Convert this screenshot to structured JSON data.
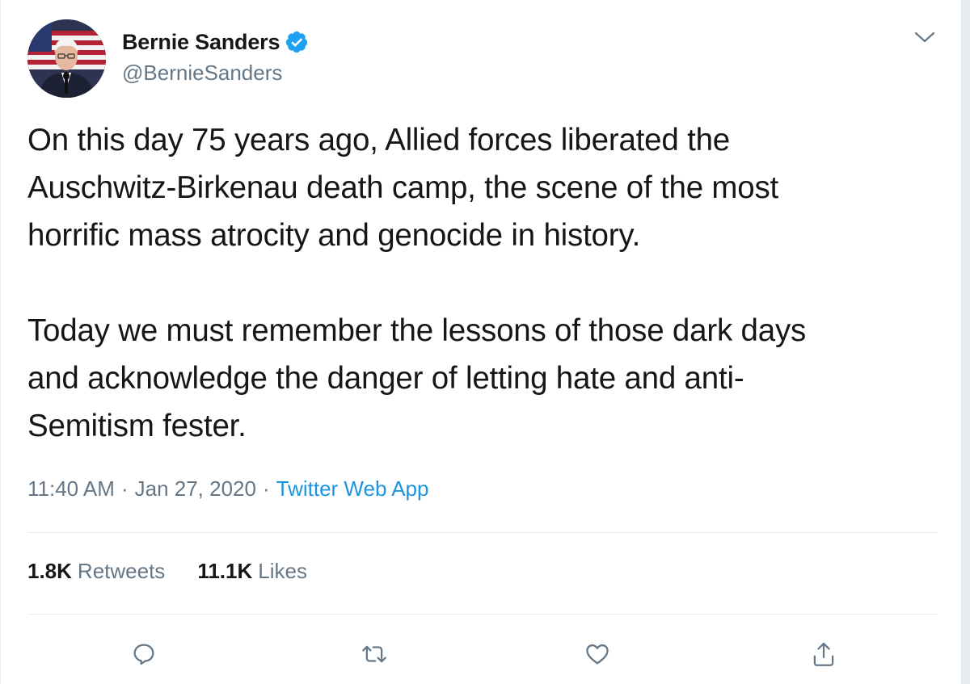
{
  "author": {
    "display_name": "Bernie Sanders",
    "handle": "@BernieSanders",
    "verified": true
  },
  "tweet": {
    "text": "On this day 75 years ago, Allied forces liberated the\nAuschwitz-Birkenau death camp, the scene of the most\nhorrific mass atrocity and genocide in history.\n\nToday we must remember the lessons of those dark days\nand acknowledge the danger of letting hate and anti-\nSemitism fester.",
    "time": "11:40 AM",
    "date": "Jan 27, 2020",
    "separator": "·",
    "source": "Twitter Web App"
  },
  "stats": {
    "retweets_count": "1.8K",
    "retweets_label": "Retweets",
    "likes_count": "11.1K",
    "likes_label": "Likes"
  },
  "icons": {
    "verified": "verified-badge-icon",
    "caret": "chevron-down-icon",
    "reply": "reply-icon",
    "retweet": "retweet-icon",
    "like": "heart-icon",
    "share": "share-icon"
  },
  "colors": {
    "text_primary": "#14171a",
    "text_secondary": "#657786",
    "link": "#1b95e0",
    "verified": "#1da1f2",
    "divider": "#e6ecf0"
  }
}
